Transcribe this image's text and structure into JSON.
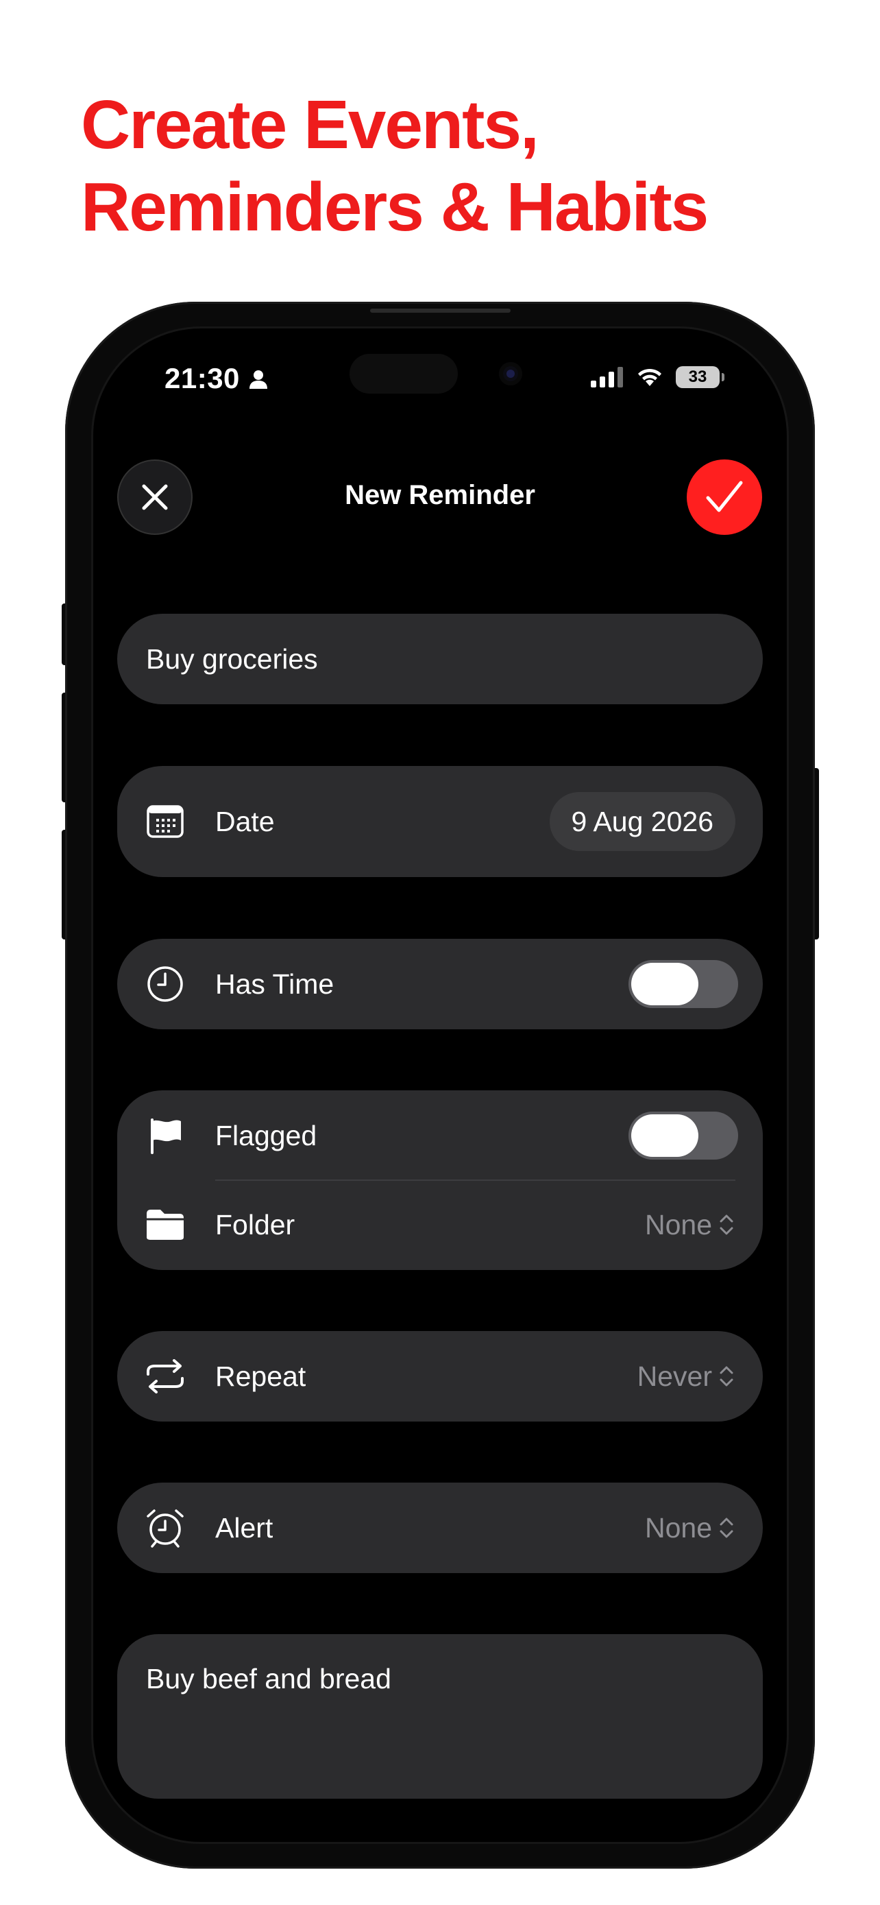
{
  "headline": {
    "line1": "Create Events,",
    "line2": "Reminders & Habits"
  },
  "status_bar": {
    "time": "21:30",
    "battery": "33"
  },
  "nav": {
    "title": "New Reminder"
  },
  "form": {
    "title_value": "Buy groceries",
    "date": {
      "label": "Date",
      "value": "9 Aug 2026"
    },
    "has_time": {
      "label": "Has Time",
      "on": false
    },
    "flagged": {
      "label": "Flagged",
      "on": false
    },
    "folder": {
      "label": "Folder",
      "value": "None"
    },
    "repeat": {
      "label": "Repeat",
      "value": "Never"
    },
    "alert": {
      "label": "Alert",
      "value": "None"
    },
    "notes_value": "Buy beef and bread"
  },
  "colors": {
    "accent": "#ff1f1f",
    "headline": "#ee1c1c",
    "card": "#2c2c2e",
    "muted": "#8e8e93"
  },
  "icons": [
    "close-icon",
    "checkmark-icon",
    "calendar-icon",
    "clock-icon",
    "flag-icon",
    "folder-icon",
    "repeat-icon",
    "alarm-icon",
    "chevron-updown-icon"
  ]
}
